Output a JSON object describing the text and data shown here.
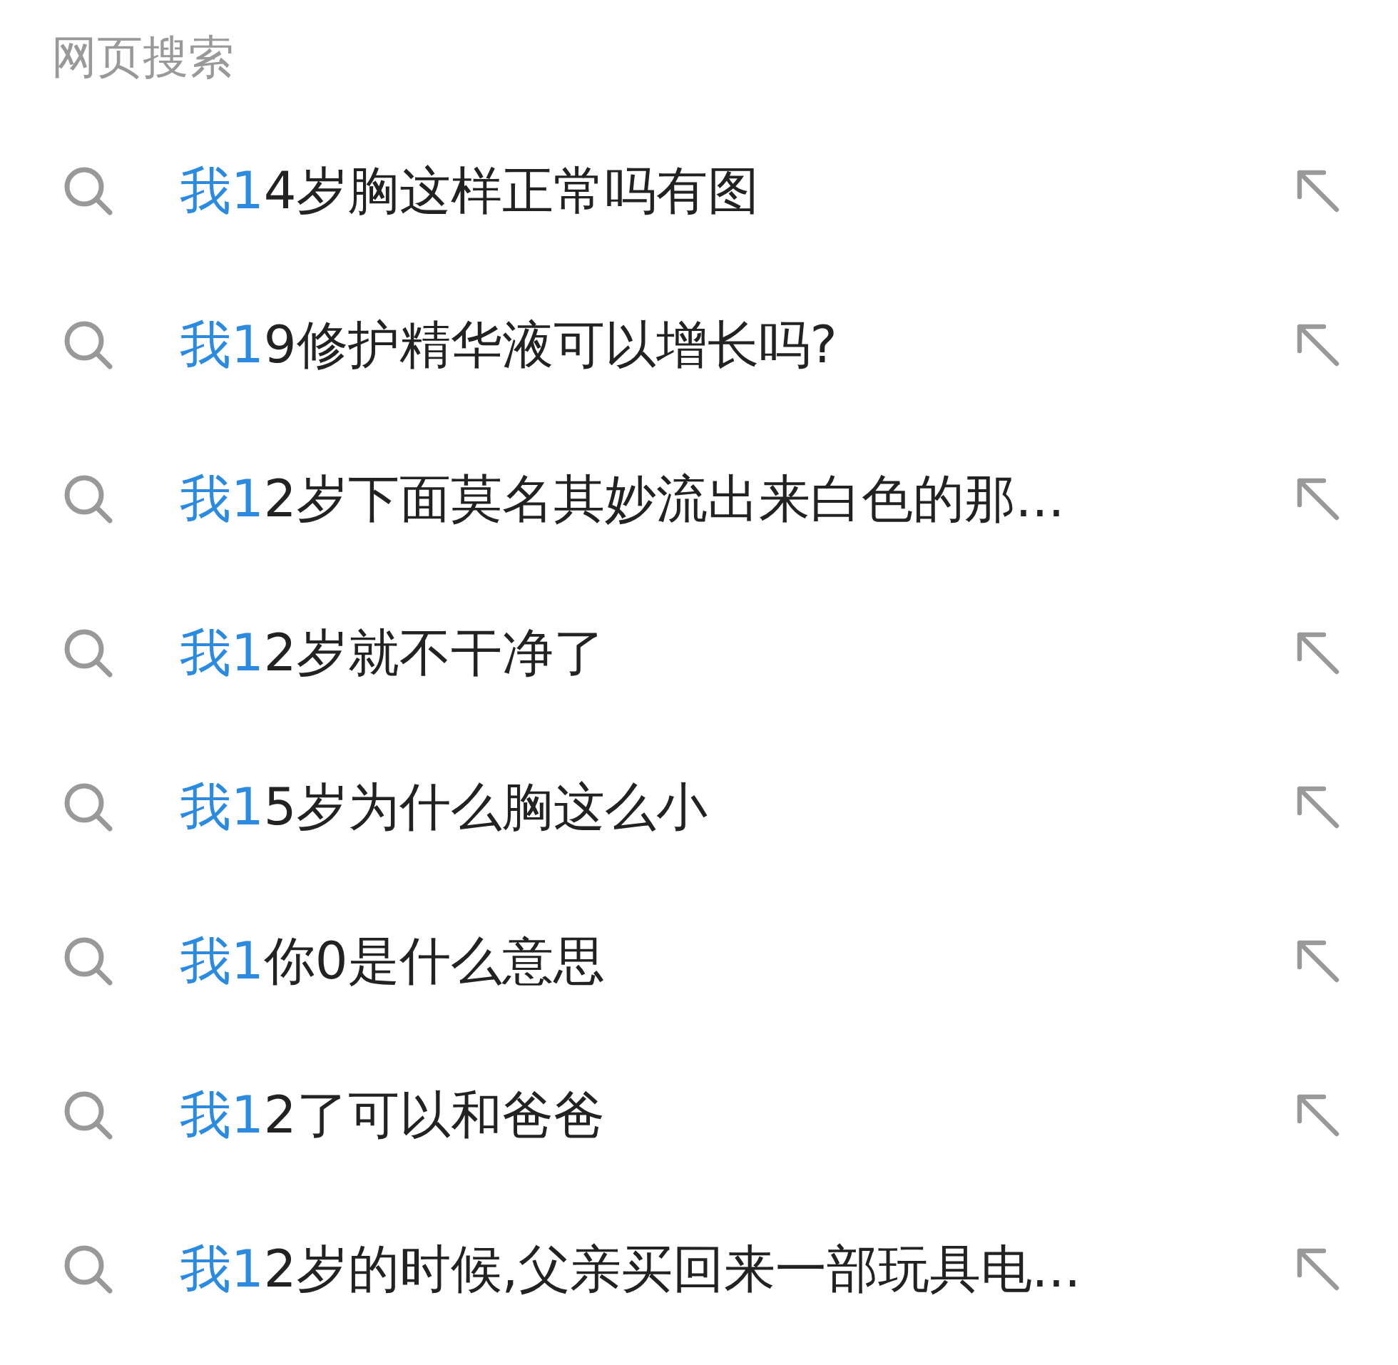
{
  "section_title": "网页搜索",
  "suggestions": [
    {
      "match": "我1",
      "rest": "4岁胸这样正常吗有图"
    },
    {
      "match": "我1",
      "rest": "9修护精华液可以增长吗?"
    },
    {
      "match": "我1",
      "rest": "2岁下面莫名其妙流出来白色的那..."
    },
    {
      "match": "我1",
      "rest": "2岁就不干净了"
    },
    {
      "match": "我1",
      "rest": "5岁为什么胸这么小"
    },
    {
      "match": "我1",
      "rest": "你0是什么意思"
    },
    {
      "match": "我1",
      "rest": "2了可以和爸爸"
    },
    {
      "match": "我1",
      "rest": "2岁的时候,父亲买回来一部玩具电..."
    }
  ]
}
